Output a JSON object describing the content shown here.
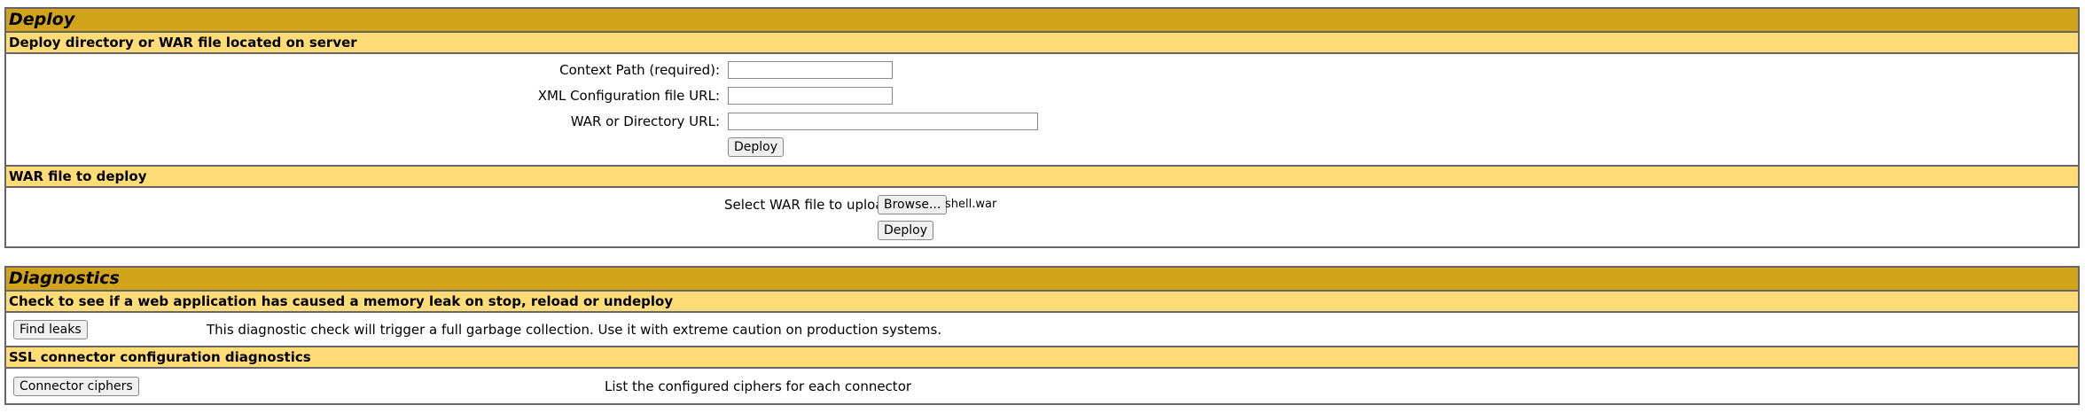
{
  "deploy": {
    "title": "Deploy",
    "server_section": {
      "heading": "Deploy directory or WAR file located on server",
      "context_path_label": "Context Path (required):",
      "context_path_value": "",
      "xml_config_label": "XML Configuration file URL:",
      "xml_config_value": "",
      "war_dir_label": "WAR or Directory URL:",
      "war_dir_value": "",
      "deploy_button": "Deploy"
    },
    "war_section": {
      "heading": "WAR file to deploy",
      "select_label": "Select WAR file to upload",
      "browse_button": "Browse...",
      "selected_file": "shell.war",
      "deploy_button": "Deploy"
    }
  },
  "diagnostics": {
    "title": "Diagnostics",
    "leak_section": {
      "heading": "Check to see if a web application has caused a memory leak on stop, reload or undeploy",
      "button": "Find leaks",
      "description": "This diagnostic check will trigger a full garbage collection. Use it with extreme caution on production systems."
    },
    "ssl_section": {
      "heading": "SSL connector configuration diagnostics",
      "button": "Connector ciphers",
      "description": "List the configured ciphers for each connector"
    }
  },
  "colors": {
    "title_bar": "#D2A41C",
    "subheading": "#FFDC75",
    "border": "#666666"
  }
}
